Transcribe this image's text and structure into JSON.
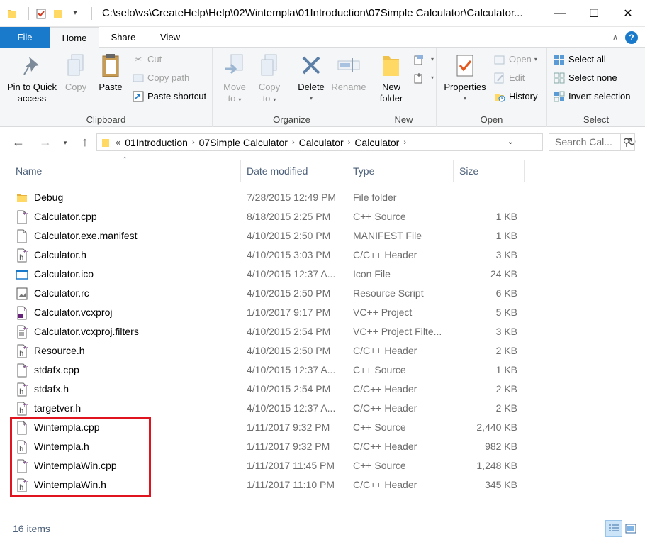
{
  "window": {
    "title": "C:\\selo\\vs\\CreateHelp\\Help\\02Wintempla\\01Introduction\\07Simple Calculator\\Calculator..."
  },
  "tabs": [
    {
      "label": "File"
    },
    {
      "label": "Home"
    },
    {
      "label": "Share"
    },
    {
      "label": "View"
    }
  ],
  "ribbon": {
    "clipboard": {
      "label": "Clipboard",
      "pin": "Pin to Quick access",
      "copy": "Copy",
      "paste": "Paste",
      "cut": "Cut",
      "copy_path": "Copy path",
      "paste_shortcut": "Paste shortcut"
    },
    "organize": {
      "label": "Organize",
      "move_to": "Move to",
      "copy_to": "Copy to",
      "delete": "Delete",
      "rename": "Rename"
    },
    "new": {
      "label": "New",
      "new_folder": "New folder"
    },
    "open": {
      "label": "Open",
      "properties": "Properties",
      "open": "Open",
      "edit": "Edit",
      "history": "History"
    },
    "select": {
      "label": "Select",
      "select_all": "Select all",
      "select_none": "Select none",
      "invert_selection": "Invert selection"
    }
  },
  "address": {
    "crumbs": [
      "01Introduction",
      "07Simple Calculator",
      "Calculator",
      "Calculator"
    ],
    "overflow": "«"
  },
  "search": {
    "placeholder": "Search Cal..."
  },
  "columns": {
    "name": "Name",
    "date": "Date modified",
    "type": "Type",
    "size": "Size"
  },
  "files": [
    {
      "name": "Debug",
      "date": "7/28/2015 12:49 PM",
      "type": "File folder",
      "size": "",
      "icon": "folder-icon"
    },
    {
      "name": "Calculator.cpp",
      "date": "8/18/2015 2:25 PM",
      "type": "C++ Source",
      "size": "1 KB",
      "icon": "cpp-file-icon"
    },
    {
      "name": "Calculator.exe.manifest",
      "date": "4/10/2015 2:50 PM",
      "type": "MANIFEST File",
      "size": "1 KB",
      "icon": "blank-file-icon"
    },
    {
      "name": "Calculator.h",
      "date": "4/10/2015 3:03 PM",
      "type": "C/C++ Header",
      "size": "3 KB",
      "icon": "header-file-icon"
    },
    {
      "name": "Calculator.ico",
      "date": "4/10/2015 12:37 A...",
      "type": "Icon File",
      "size": "24 KB",
      "icon": "ico-file-icon"
    },
    {
      "name": "Calculator.rc",
      "date": "4/10/2015 2:50 PM",
      "type": "Resource Script",
      "size": "6 KB",
      "icon": "rc-file-icon"
    },
    {
      "name": "Calculator.vcxproj",
      "date": "1/10/2017 9:17 PM",
      "type": "VC++ Project",
      "size": "5 KB",
      "icon": "vcxproj-file-icon"
    },
    {
      "name": "Calculator.vcxproj.filters",
      "date": "4/10/2015 2:54 PM",
      "type": "VC++ Project Filte...",
      "size": "3 KB",
      "icon": "filters-file-icon"
    },
    {
      "name": "Resource.h",
      "date": "4/10/2015 2:50 PM",
      "type": "C/C++ Header",
      "size": "2 KB",
      "icon": "header-file-icon"
    },
    {
      "name": "stdafx.cpp",
      "date": "4/10/2015 12:37 A...",
      "type": "C++ Source",
      "size": "1 KB",
      "icon": "cpp-file-icon"
    },
    {
      "name": "stdafx.h",
      "date": "4/10/2015 2:54 PM",
      "type": "C/C++ Header",
      "size": "2 KB",
      "icon": "header-file-icon"
    },
    {
      "name": "targetver.h",
      "date": "4/10/2015 12:37 A...",
      "type": "C/C++ Header",
      "size": "2 KB",
      "icon": "header-file-icon"
    },
    {
      "name": "Wintempla.cpp",
      "date": "1/11/2017 9:32 PM",
      "type": "C++ Source",
      "size": "2,440 KB",
      "icon": "cpp-file-icon"
    },
    {
      "name": "Wintempla.h",
      "date": "1/11/2017 9:32 PM",
      "type": "C/C++ Header",
      "size": "982 KB",
      "icon": "header-file-icon"
    },
    {
      "name": "WintemplaWin.cpp",
      "date": "1/11/2017 11:45 PM",
      "type": "C++ Source",
      "size": "1,248 KB",
      "icon": "cpp-file-icon"
    },
    {
      "name": "WintemplaWin.h",
      "date": "1/11/2017 11:10 PM",
      "type": "C/C++ Header",
      "size": "345 KB",
      "icon": "header-file-icon"
    }
  ],
  "status": {
    "item_count": "16 items"
  },
  "colors": {
    "accent": "#1979ca",
    "highlight_box": "#e0141e",
    "header_text": "#4c607a"
  }
}
